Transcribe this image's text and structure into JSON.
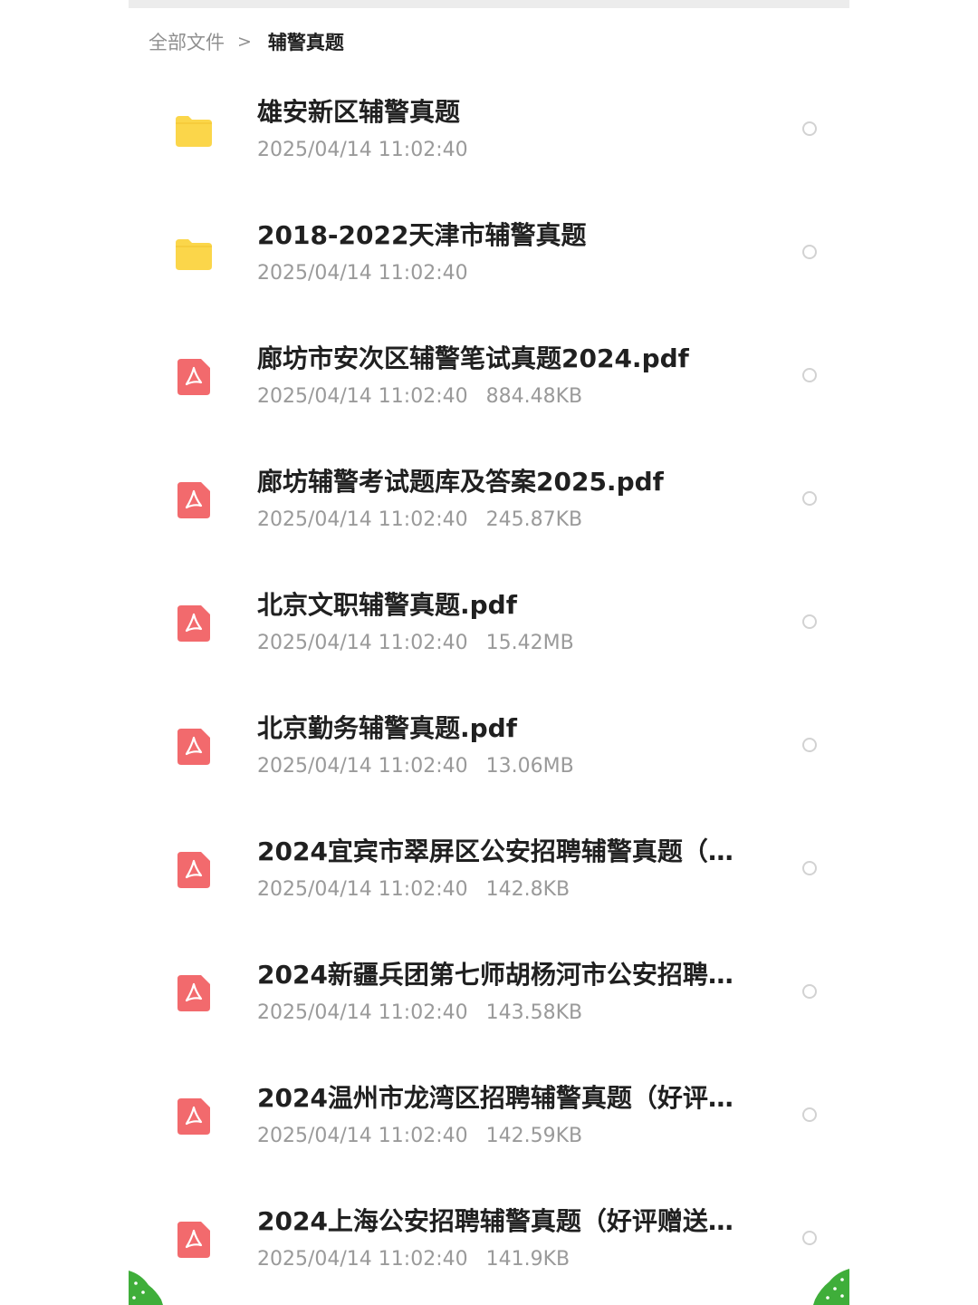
{
  "breadcrumb": {
    "root": "全部文件",
    "separator": ">",
    "current": "辅警真题"
  },
  "colors": {
    "folder": "#fbd64a",
    "pdf": "#f26a6d",
    "title": "#202020",
    "meta": "#9a9a9a",
    "deco_green": "#3fae3a"
  },
  "files": [
    {
      "type": "folder",
      "icon": "folder-icon",
      "name": "雄安新区辅警真题",
      "date": "2025/04/14 11:02:40",
      "size": ""
    },
    {
      "type": "folder",
      "icon": "folder-icon",
      "name": "2018-2022天津市辅警真题",
      "date": "2025/04/14 11:02:40",
      "size": ""
    },
    {
      "type": "pdf",
      "icon": "pdf-icon",
      "name": "廊坊市安次区辅警笔试真题2024.pdf",
      "date": "2025/04/14 11:02:40",
      "size": "884.48KB"
    },
    {
      "type": "pdf",
      "icon": "pdf-icon",
      "name": "廊坊辅警考试题库及答案2025.pdf",
      "date": "2025/04/14 11:02:40",
      "size": "245.87KB"
    },
    {
      "type": "pdf",
      "icon": "pdf-icon",
      "name": "北京文职辅警真题.pdf",
      "date": "2025/04/14 11:02:40",
      "size": "15.42MB"
    },
    {
      "type": "pdf",
      "icon": "pdf-icon",
      "name": "北京勤务辅警真题.pdf",
      "date": "2025/04/14 11:02:40",
      "size": "13.06MB"
    },
    {
      "type": "pdf",
      "icon": "pdf-icon",
      "name": "2024宜宾市翠屏区公安招聘辅警真题（…",
      "date": "2025/04/14 11:02:40",
      "size": "142.8KB"
    },
    {
      "type": "pdf",
      "icon": "pdf-icon",
      "name": "2024新疆兵团第七师胡杨河市公安招聘…",
      "date": "2025/04/14 11:02:40",
      "size": "143.58KB"
    },
    {
      "type": "pdf",
      "icon": "pdf-icon",
      "name": "2024温州市龙湾区招聘辅警真题（好评…",
      "date": "2025/04/14 11:02:40",
      "size": "142.59KB"
    },
    {
      "type": "pdf",
      "icon": "pdf-icon",
      "name": "2024上海公安招聘辅警真题（好评赠送…",
      "date": "2025/04/14 11:02:40",
      "size": "141.9KB"
    }
  ]
}
